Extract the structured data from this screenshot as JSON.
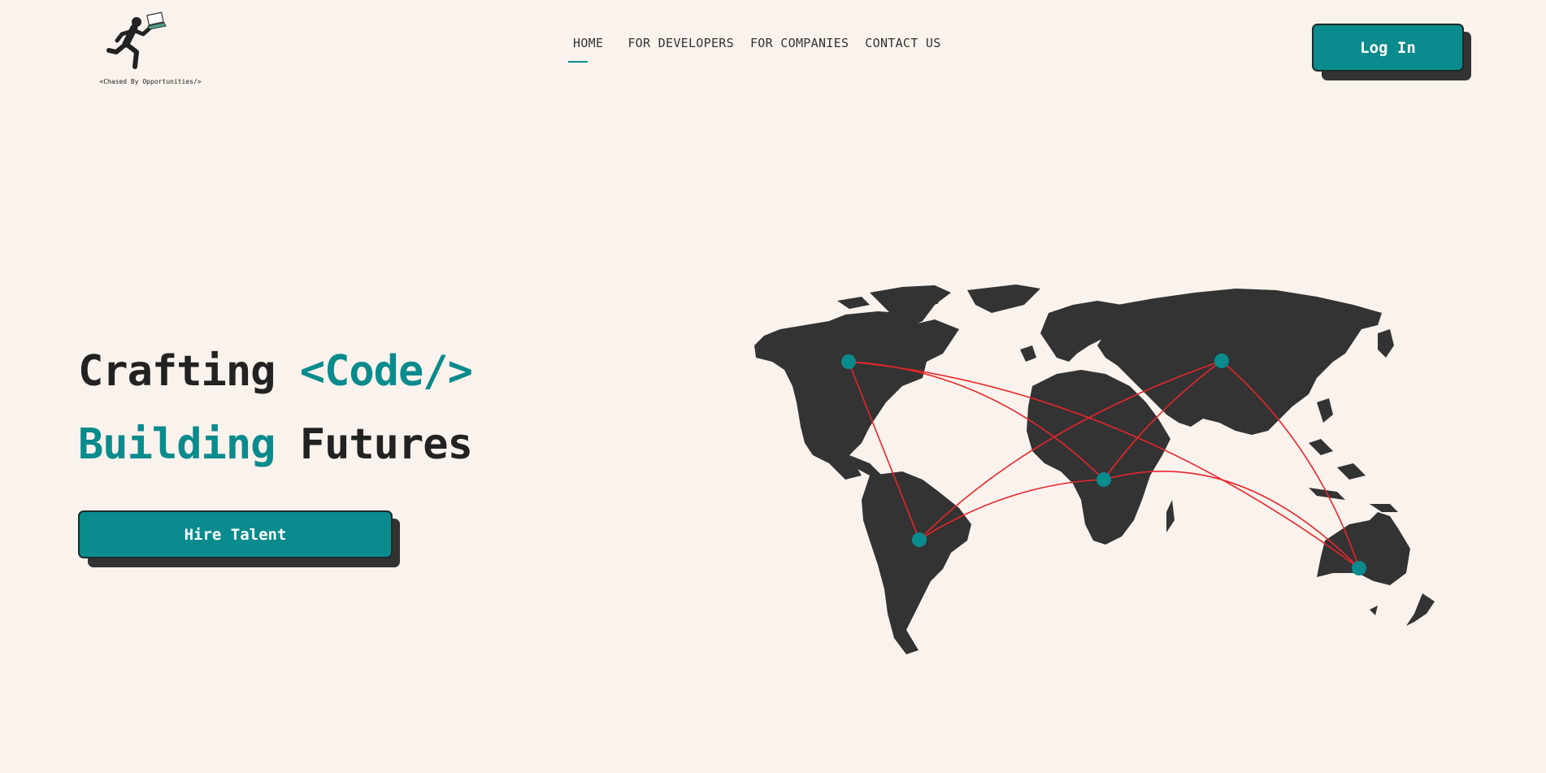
{
  "logo": {
    "tagline": "<Chased By Opportunities/>"
  },
  "nav": {
    "items": [
      {
        "label": "HOME",
        "active": true
      },
      {
        "label": "FOR DEVELOPERS"
      },
      {
        "label": "FOR COMPANIES"
      },
      {
        "label": "CONTACT US"
      }
    ]
  },
  "header": {
    "login_label": "Log In"
  },
  "hero": {
    "line1_plain": "Crafting ",
    "line1_accent": "<Code/>",
    "line2_accent": "Building",
    "line2_plain": " Futures",
    "cta_label": "Hire Talent"
  },
  "colors": {
    "accent": "#0a8b8d",
    "background": "#faf2ec",
    "map": "#333333",
    "connections": "#e8262c"
  },
  "icons": [
    "running-person-logo-icon",
    "laptop-icon",
    "world-map-illustration"
  ]
}
